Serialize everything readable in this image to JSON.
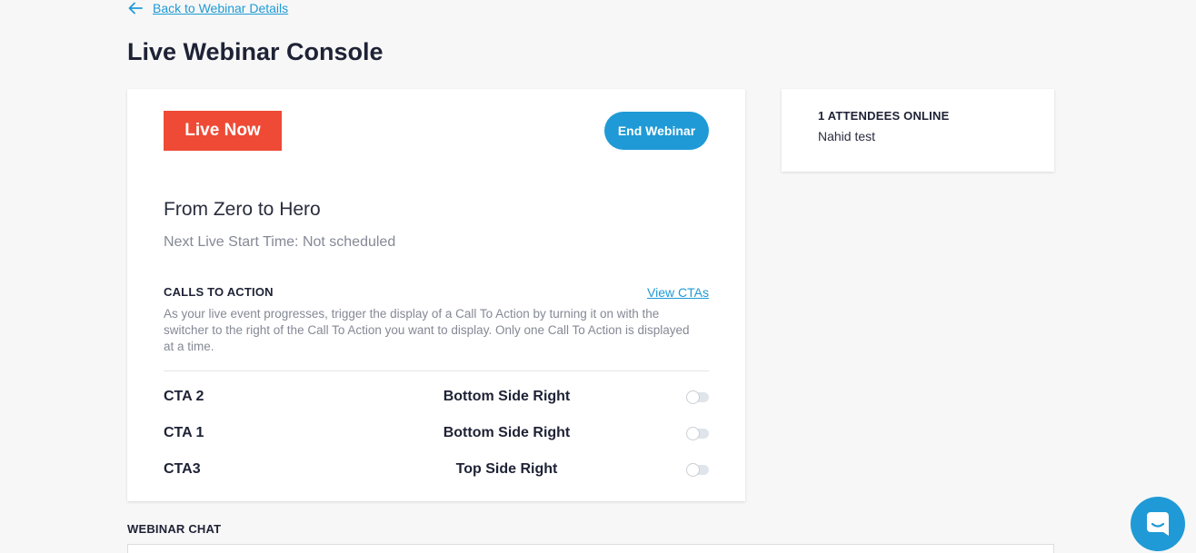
{
  "nav": {
    "back_label": "Back to Webinar Details"
  },
  "page": {
    "title": "Live Webinar Console"
  },
  "console": {
    "live_badge": "Live Now",
    "end_button": "End Webinar",
    "webinar_title": "From Zero to Hero",
    "next_live": "Next Live Start Time: Not scheduled",
    "cta_section": {
      "heading": "CALLS TO ACTION",
      "view_link": "View CTAs",
      "description": "As your live event progresses, trigger the display of a Call To Action by turning it on with the switcher to the right of the Call To Action you want to display. Only one Call To Action is displayed at a time.",
      "items": [
        {
          "name": "CTA 2",
          "position": "Bottom Side Right",
          "enabled": false
        },
        {
          "name": "CTA 1",
          "position": "Bottom Side Right",
          "enabled": false
        },
        {
          "name": "CTA3",
          "position": "Top Side Right",
          "enabled": false
        }
      ]
    }
  },
  "attendees": {
    "count_label": "1 ATTENDEES ONLINE",
    "list": [
      "Nahid test"
    ]
  },
  "chat": {
    "heading": "WEBINAR CHAT"
  },
  "colors": {
    "accent": "#1f9ad6",
    "live_badge": "#ee4a35",
    "text_dark": "#1e2235",
    "text_muted": "#858995",
    "background": "#f7f7f7"
  },
  "icons": {
    "back": "arrow-left-icon",
    "chat_launcher": "chat-bubble-icon"
  }
}
